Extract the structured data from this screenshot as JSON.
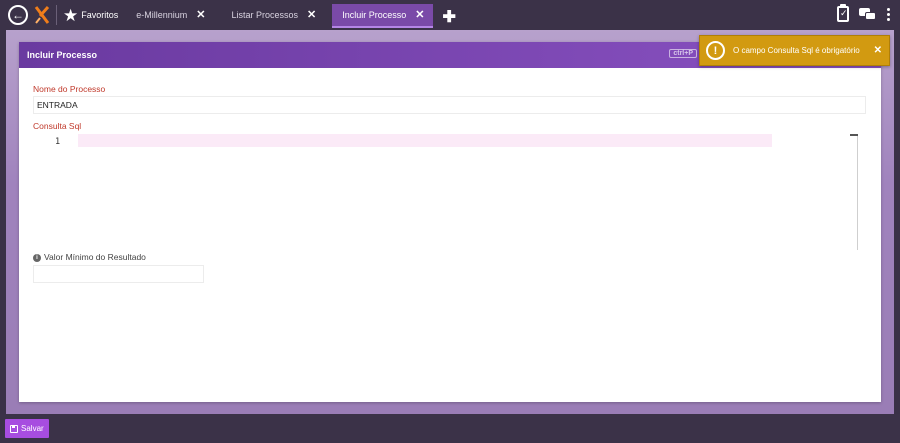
{
  "topbar": {
    "favorites_label": "Favoritos",
    "tabs": [
      {
        "label": "e-Millennium",
        "active": false
      },
      {
        "label": "Listar Processos",
        "active": false
      },
      {
        "label": "Incluir Processo",
        "active": true
      }
    ],
    "close_glyph": "✕",
    "add_glyph": "✚",
    "back_glyph": "←",
    "star_glyph": "★"
  },
  "icons": {
    "back": "back-circle-icon",
    "logo": "x-logo",
    "favorites": "star-icon",
    "clipboard": "clipboard-check-icon",
    "chat": "chat-bubbles-icon",
    "menu": "kebab-menu-icon",
    "toast": "exclamation-circle-icon",
    "save": "floppy-disk-icon",
    "info": "info-circle-icon"
  },
  "panel": {
    "title": "Incluir Processo",
    "shortcut_key": "ctrl+P"
  },
  "form": {
    "nome_label": "Nome do Processo",
    "nome_value": "ENTRADA",
    "sql_label": "Consulta Sql",
    "sql_line_number": "1",
    "valor_label": "Valor Mínimo do Resultado",
    "valor_value": ""
  },
  "toast": {
    "message": "O campo Consulta Sql é obrigatório",
    "close_glyph": "✕",
    "icon_glyph": "!"
  },
  "footer": {
    "save_label": "Salvar"
  },
  "colors": {
    "topbar": "#3b3248",
    "active_tab": "#7a4aa8",
    "panel_header": "#7c45b3",
    "required_label": "#c0392b",
    "toast": "#d29a11",
    "save_button": "#a74de0"
  }
}
